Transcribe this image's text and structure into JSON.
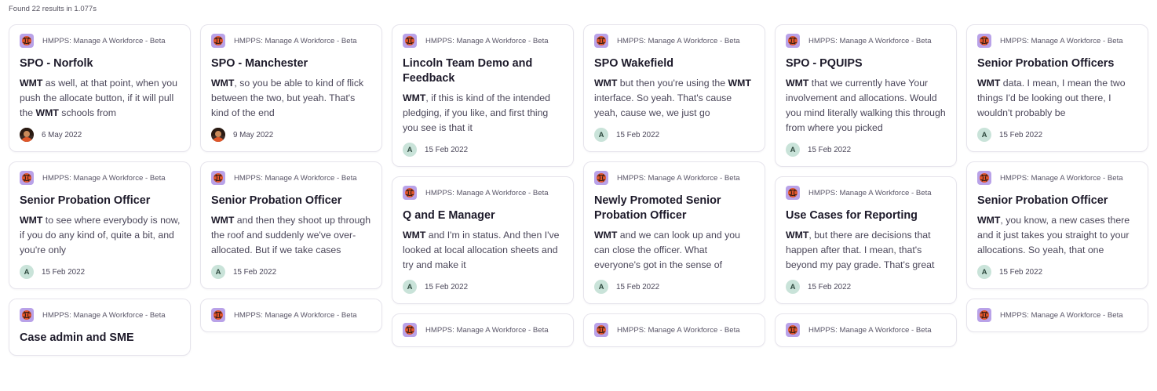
{
  "results_count": "Found 22 results in 1.077s",
  "colors": {
    "accent_icon_bg": "#b9a2e8",
    "avatar_letter_bg": "#c9e3d9",
    "card_border": "#e6e4ec"
  },
  "columns": [
    [
      {
        "source": "HMPPS: Manage A Workforce - Beta",
        "title": "SPO - Norfolk",
        "snippet": "<b>WMT</b> as well, at that point, when you push the allocate button, if it will pull the <b>WMT</b> schools from",
        "avatar": {
          "type": "photo",
          "letter": ""
        },
        "date": "6 May 2022"
      },
      {
        "source": "HMPPS: Manage A Workforce - Beta",
        "title": "Senior Probation Officer",
        "snippet": "<b>WMT</b> to see where everybody is now, if you do any kind of, quite a bit, and you're only",
        "avatar": {
          "type": "letter",
          "letter": "A"
        },
        "date": "15 Feb 2022"
      },
      {
        "source": "HMPPS: Manage A Workforce - Beta",
        "title": "Case admin and SME",
        "snippet": "",
        "avatar": {
          "type": "letter",
          "letter": "A"
        },
        "date": ""
      }
    ],
    [
      {
        "source": "HMPPS: Manage A Workforce - Beta",
        "title": "SPO - Manchester",
        "snippet": "<b>WMT</b>, so you be able to kind of flick between the two, but yeah. That's kind of the end",
        "avatar": {
          "type": "photo",
          "letter": ""
        },
        "date": "9 May 2022"
      },
      {
        "source": "HMPPS: Manage A Workforce - Beta",
        "title": "Senior Probation Officer",
        "snippet": "<b>WMT</b> and then they shoot up through the roof and suddenly we've over-allocated. But if we take cases",
        "avatar": {
          "type": "letter",
          "letter": "A"
        },
        "date": "15 Feb 2022"
      },
      {
        "source": "HMPPS: Manage A Workforce - Beta",
        "title": "",
        "snippet": "",
        "avatar": {
          "type": "letter",
          "letter": "A"
        },
        "date": ""
      }
    ],
    [
      {
        "source": "HMPPS: Manage A Workforce - Beta",
        "title": "Lincoln Team Demo and Feedback",
        "snippet": "<b>WMT</b>, if this is kind of the intended pledging, if you like, and first thing you see is that it",
        "avatar": {
          "type": "letter",
          "letter": "A"
        },
        "date": "15 Feb 2022"
      },
      {
        "source": "HMPPS: Manage A Workforce - Beta",
        "title": "Q and E Manager",
        "snippet": "<b>WMT</b> and I'm in status. And then I've looked at local allocation sheets and try and make it",
        "avatar": {
          "type": "letter",
          "letter": "A"
        },
        "date": "15 Feb 2022"
      },
      {
        "source": "HMPPS: Manage A Workforce - Beta",
        "title": "",
        "snippet": "",
        "avatar": {
          "type": "letter",
          "letter": "A"
        },
        "date": ""
      }
    ],
    [
      {
        "source": "HMPPS: Manage A Workforce - Beta",
        "title": "SPO Wakefield",
        "snippet": "<b>WMT</b> but then you're using the <b>WMT</b> interface. So yeah. That's cause yeah, cause we, we just go",
        "avatar": {
          "type": "letter",
          "letter": "A"
        },
        "date": "15 Feb 2022"
      },
      {
        "source": "HMPPS: Manage A Workforce - Beta",
        "title": "Newly Promoted Senior Probation Officer",
        "snippet": "<b>WMT</b> and we can look up and you can close the officer. What everyone's got in the sense of",
        "avatar": {
          "type": "letter",
          "letter": "A"
        },
        "date": "15 Feb 2022"
      },
      {
        "source": "HMPPS: Manage A Workforce - Beta",
        "title": "",
        "snippet": "",
        "avatar": {
          "type": "letter",
          "letter": "A"
        },
        "date": ""
      }
    ],
    [
      {
        "source": "HMPPS: Manage A Workforce - Beta",
        "title": "SPO - PQUIPS",
        "snippet": "<b>WMT</b> that we currently have Your involvement and allocations. Would you mind literally walking this through from where you picked",
        "avatar": {
          "type": "letter",
          "letter": "A"
        },
        "date": "15 Feb 2022"
      },
      {
        "source": "HMPPS: Manage A Workforce - Beta",
        "title": "Use Cases for Reporting",
        "snippet": "<b>WMT</b>, but there are decisions that happen after that. I mean, that's beyond my pay grade. That's great",
        "avatar": {
          "type": "letter",
          "letter": "A"
        },
        "date": "15 Feb 2022"
      },
      {
        "source": "HMPPS: Manage A Workforce - Beta",
        "title": "",
        "snippet": "",
        "avatar": {
          "type": "letter",
          "letter": "A"
        },
        "date": ""
      }
    ],
    [
      {
        "source": "HMPPS: Manage A Workforce - Beta",
        "title": "Senior Probation Officers",
        "snippet": "<b>WMT</b> data. I mean, I mean the two things I'd be looking out there, I wouldn't probably be",
        "avatar": {
          "type": "letter",
          "letter": "A"
        },
        "date": "15 Feb 2022"
      },
      {
        "source": "HMPPS: Manage A Workforce - Beta",
        "title": "Senior Probation Officer",
        "snippet": "<b>WMT</b>, you know, a new cases there and it just takes you straight to your allocations. So yeah, that one",
        "avatar": {
          "type": "letter",
          "letter": "A"
        },
        "date": "15 Feb 2022"
      },
      {
        "source": "HMPPS: Manage A Workforce - Beta",
        "title": "",
        "snippet": "",
        "avatar": {
          "type": "letter",
          "letter": "A"
        },
        "date": ""
      }
    ]
  ]
}
